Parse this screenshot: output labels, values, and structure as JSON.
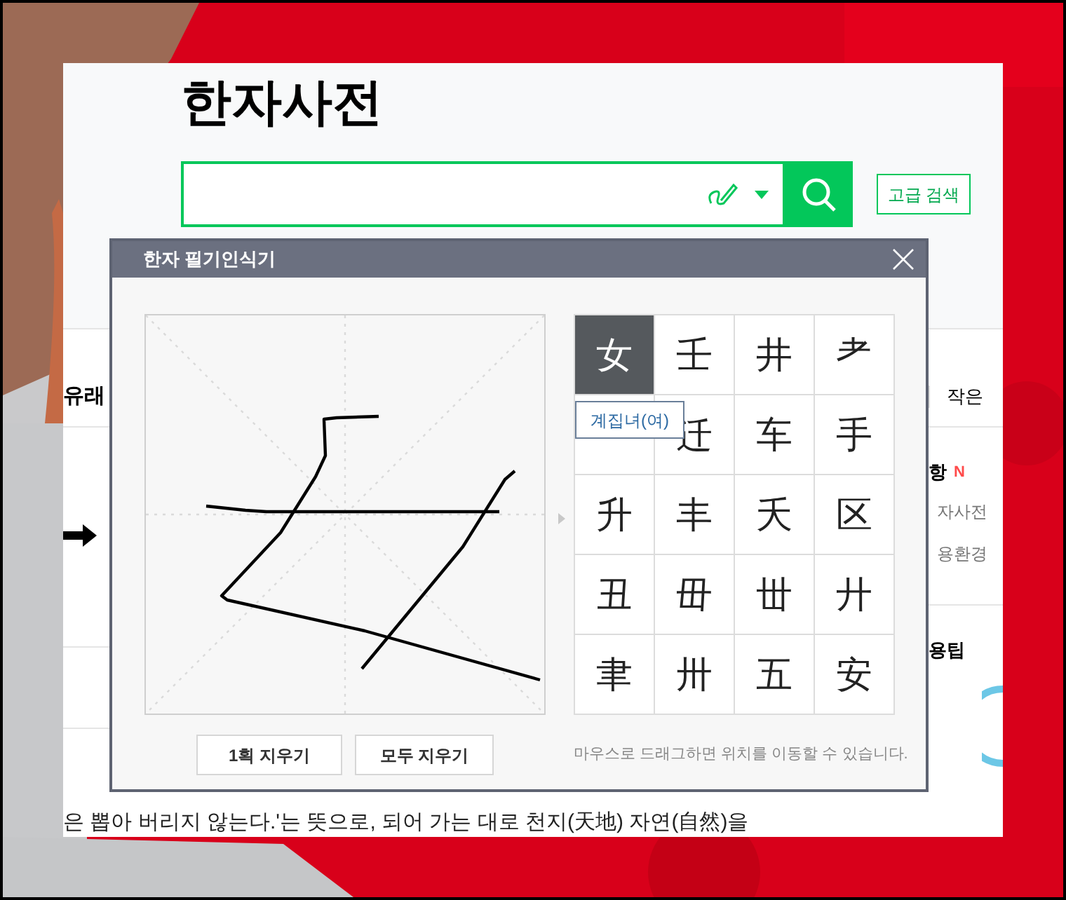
{
  "page": {
    "title": "한자사전",
    "advanced_search": "고급 검색",
    "left_labels": [
      "유래"
    ],
    "side": [
      {
        "kind": "tab",
        "text": "작은"
      },
      {
        "kind": "heading",
        "text": "항",
        "badge": "N"
      },
      {
        "kind": "line",
        "text": "자사전"
      },
      {
        "kind": "line",
        "text": "용환경"
      },
      {
        "kind": "heading",
        "text": "용팁"
      }
    ],
    "article_text": "은 뽑아 버리지 않는다.'는 뜻으로, 되어 가는 대로 천지(天地) 자연(自然)을"
  },
  "dialog": {
    "title": "한자 필기인식기",
    "candidates": [
      {
        "char": "女",
        "selected": true,
        "tooltip": "계집녀(여)"
      },
      {
        "char": "壬",
        "selected": false
      },
      {
        "char": "井",
        "selected": false
      },
      {
        "char": "耂",
        "selected": false
      },
      {
        "selected": false
      },
      {
        "char": "迁",
        "selected": false
      },
      {
        "char": "车",
        "selected": false
      },
      {
        "char": "手",
        "selected": false
      },
      {
        "char": "升",
        "selected": false
      },
      {
        "char": "丰",
        "selected": false
      },
      {
        "char": "夭",
        "selected": false
      },
      {
        "char": "区",
        "selected": false
      },
      {
        "char": "丑",
        "selected": false
      },
      {
        "char": "毌",
        "selected": false
      },
      {
        "char": "丗",
        "selected": false
      },
      {
        "char": "廾",
        "selected": false
      },
      {
        "char": "聿",
        "selected": false
      },
      {
        "char": "卅",
        "selected": false
      },
      {
        "char": "五",
        "selected": false
      },
      {
        "char": "安",
        "selected": false
      }
    ],
    "buttons": [
      "1획 지우기",
      "모두 지우기"
    ],
    "hint": "마우스로 드래그하면 위치를 이동할 수 있습니다."
  }
}
